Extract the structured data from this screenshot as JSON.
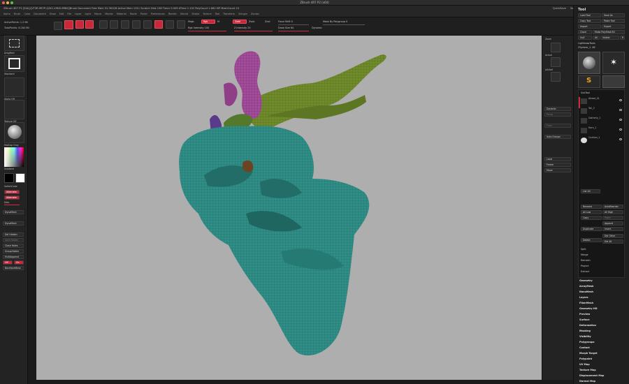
{
  "window": {
    "title": "ZBrush 4R7 P2 (x64)",
    "traffic_colors": [
      "#ec5f57",
      "#e3bd3d",
      "#5dc24b"
    ]
  },
  "menubar": {
    "info_text": "ZBrush 4R7 P2 [S4A]:[VT3R-9R7P-Q2K1-V9N3-9RBQ]Brush Document  Free Mem 31.561GB  Active Mem 1311  Scratch Disk 156  Timer 0.009  ATime 1.152  PolyCount 2.682 MP  MeshCount 10",
    "right_items": [
      "QuickSave",
      "See-through 0",
      "Menus",
      "DefaultZScript"
    ],
    "menus": [
      "Alpha",
      "Brush",
      "Color",
      "Document",
      "Draw",
      "Edit",
      "File",
      "Layer",
      "Light",
      "Macro",
      "Marker",
      "Material",
      "Movie",
      "Picker",
      "Preferences",
      "Render",
      "Stencil",
      "Stroke",
      "Texture",
      "Tool",
      "Transform",
      "Zplugin",
      "Zscript"
    ]
  },
  "top": {
    "active_points": "ActivePoints: 1.2 Mil",
    "total_points": "TotalPoints: 6.284 Mil",
    "btn_draw": "Draw",
    "btn_move": "Move",
    "btn_scale": "Scale",
    "btn_rotate": "Rotate",
    "mrgb": "Mrgb",
    "rgb": "Rgb",
    "m": "M",
    "zadd": "Zadd",
    "zsub": "Zsub",
    "zcut": "Zcut",
    "rgb_intensity": "Rgb Intensity 100",
    "z_intensity": "Z Intensity 25",
    "focal_shift": "Focal Shift 0",
    "draw_size": "Draw Size 64",
    "dynamic": "Dynamic",
    "mask_polygroup": "Mask By Polygroup 0"
  },
  "left": {
    "lightbox": "LightBox",
    "brush": "Standard",
    "stroke": "DragRect",
    "alpha": "Alpha Off",
    "texture": "Texture Off",
    "material": "MatCap Gray",
    "gradient": "Gradient",
    "switch_color": "SwitchColor",
    "alternate": "Alternate",
    "dots": "Dots",
    "dynamesh": "DynaMesh",
    "del_hidden": "Del Hidden",
    "split_hidden": "Split Hidden",
    "close_holes": "Close Holes",
    "group_visible": "GroupVisible",
    "insert_append": "MultiAppend",
    "off": "Off",
    "on": "On",
    "backface": "BackfaceMask"
  },
  "rshelf": {
    "persp": "Persp",
    "floor": "Floor",
    "local": "Local",
    "frame": "Frame",
    "move": "Move",
    "zoom3d": "Scale",
    "rotate": "Rotate",
    "polyf": "PolyF",
    "transp": "Transp",
    "ghost": "Ghost",
    "solo": "Solo",
    "xpose": "Xpose",
    "zoom": "Zoom",
    "actual": "Actual",
    "aahalf": "AAHalf",
    "dynamic": "Dynamic",
    "auto_groups": "Auto Groups"
  },
  "tray": {
    "header": "Tool",
    "load": "Load Tool",
    "save": "Save As",
    "copy": "Copy Tool",
    "paste": "Paste Tool",
    "import": "Import",
    "export": "Export",
    "clone": "Clone",
    "make_polymesh": "Make PolyMesh3D",
    "goz": "GoZ",
    "all": "All",
    "visible": "Visible",
    "r": "R",
    "lightbox_tools": "Lightbox▸Tools",
    "current_tool": "ZSphere_1. 48",
    "subtool": "SubTool",
    "subtools": [
      "Ahead_01",
      "Tail_2",
      "Gatherly_1",
      "Horn_1",
      "Cushion_1"
    ],
    "list_all": "List All",
    "rename": "Rename",
    "auto_reorder": "AutoReorder",
    "all_low": "All Low",
    "all_high": "All High",
    "copy_st": "Copy",
    "paste_st": "Paste",
    "append": "Append",
    "duplicate": "Duplicate",
    "insert": "Insert",
    "delete": "Delete",
    "del_other": "Del Other",
    "del_all": "Del All",
    "split": "Split",
    "merge": "Merge",
    "remesh": "Remesh",
    "project": "Project",
    "extract": "Extract",
    "menus": [
      "Geometry",
      "ArrayMesh",
      "NanoMesh",
      "Layers",
      "FiberMesh",
      "Geometry HD",
      "Preview",
      "Surface",
      "Deformation",
      "Masking",
      "Visibility",
      "Polygroups",
      "Contact",
      "Morph Target",
      "Polypaint",
      "UV Map",
      "Texture Map",
      "Displacement Map",
      "Normal Map",
      "Vector Displacement Map"
    ]
  },
  "colors": {
    "accent_red": "#d12b3b",
    "canvas": "#aeaeae",
    "body_teal": "#2f8e87",
    "horn_green": "#6f8b2c",
    "feather_magenta": "#a24d9a",
    "leaf_purple": "#5a3a8a"
  }
}
